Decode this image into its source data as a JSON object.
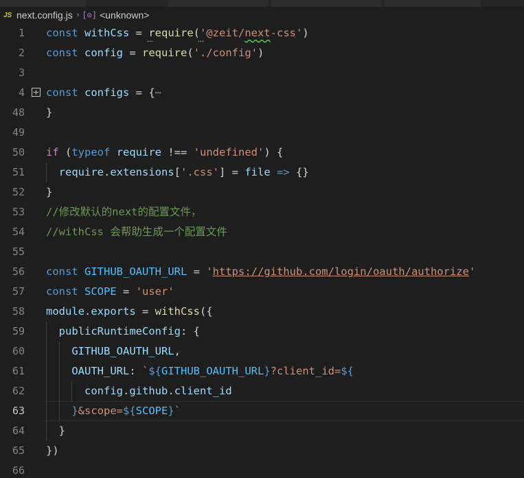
{
  "breadcrumb": {
    "file_badge": "JS",
    "file_name": "next.config.js",
    "separator": "›",
    "symbol_badge": "[⊙]",
    "symbol_name": "<unknown>"
  },
  "active_line": "63",
  "lines": [
    {
      "n": "1",
      "tokens": [
        [
          "kw",
          "const"
        ],
        [
          "pun",
          " "
        ],
        [
          "var",
          "withCss"
        ],
        [
          "pun",
          " = "
        ],
        [
          "fn",
          "require"
        ],
        [
          "pun",
          "("
        ],
        [
          "str",
          "'@zeit/next-css'"
        ],
        [
          "pun",
          ")"
        ]
      ]
    },
    {
      "n": "2",
      "tokens": [
        [
          "kw",
          "const"
        ],
        [
          "pun",
          " "
        ],
        [
          "var",
          "config"
        ],
        [
          "pun",
          " = "
        ],
        [
          "fn",
          "require"
        ],
        [
          "pun",
          "("
        ],
        [
          "str",
          "'./config'"
        ],
        [
          "pun",
          ")"
        ]
      ]
    },
    {
      "n": "3",
      "tokens": []
    },
    {
      "n": "4",
      "tokens": [
        [
          "kw",
          "const"
        ],
        [
          "pun",
          " "
        ],
        [
          "var",
          "configs"
        ],
        [
          "pun",
          " = {"
        ],
        [
          "fold-ell",
          "⋯"
        ]
      ]
    },
    {
      "n": "48",
      "tokens": [
        [
          "pun",
          "}"
        ]
      ]
    },
    {
      "n": "49",
      "tokens": []
    },
    {
      "n": "50",
      "tokens": [
        [
          "ctl",
          "if"
        ],
        [
          "pun",
          " ("
        ],
        [
          "kw",
          "typeof"
        ],
        [
          "pun",
          " "
        ],
        [
          "var",
          "require"
        ],
        [
          "pun",
          " !== "
        ],
        [
          "str",
          "'undefined'"
        ],
        [
          "pun",
          ") {"
        ]
      ]
    },
    {
      "n": "51",
      "tokens": [
        [
          "pun",
          "  "
        ],
        [
          "var",
          "require"
        ],
        [
          "pun",
          "."
        ],
        [
          "var",
          "extensions"
        ],
        [
          "pun",
          "["
        ],
        [
          "str",
          "'.css'"
        ],
        [
          "pun",
          "] = "
        ],
        [
          "var",
          "file"
        ],
        [
          "pun",
          " "
        ],
        [
          "kw",
          "=>"
        ],
        [
          "pun",
          " {}"
        ]
      ]
    },
    {
      "n": "52",
      "tokens": [
        [
          "pun",
          "}"
        ]
      ]
    },
    {
      "n": "53",
      "tokens": [
        [
          "cm",
          "//修改默认的next的配置文件，"
        ]
      ]
    },
    {
      "n": "54",
      "tokens": [
        [
          "cm",
          "//withCss 会帮助生成一个配置文件"
        ]
      ]
    },
    {
      "n": "55",
      "tokens": []
    },
    {
      "n": "56",
      "tokens": [
        [
          "kw",
          "const"
        ],
        [
          "pun",
          " "
        ],
        [
          "const",
          "GITHUB_OAUTH_URL"
        ],
        [
          "pun",
          " = "
        ],
        [
          "str",
          "'"
        ],
        [
          "str link",
          "https://github.com/login/oauth/authorize"
        ],
        [
          "str",
          "'"
        ]
      ]
    },
    {
      "n": "57",
      "tokens": [
        [
          "kw",
          "const"
        ],
        [
          "pun",
          " "
        ],
        [
          "const",
          "SCOPE"
        ],
        [
          "pun",
          " = "
        ],
        [
          "str",
          "'user'"
        ]
      ]
    },
    {
      "n": "58",
      "tokens": [
        [
          "var",
          "module"
        ],
        [
          "pun",
          "."
        ],
        [
          "var",
          "exports"
        ],
        [
          "pun",
          " = "
        ],
        [
          "fn",
          "withCss"
        ],
        [
          "pun",
          "({"
        ]
      ]
    },
    {
      "n": "59",
      "tokens": [
        [
          "pun",
          "  "
        ],
        [
          "var",
          "publicRuntimeConfig"
        ],
        [
          "pun",
          ": {"
        ]
      ]
    },
    {
      "n": "60",
      "tokens": [
        [
          "pun",
          "    "
        ],
        [
          "var",
          "GITHUB_OAUTH_URL"
        ],
        [
          "pun",
          ","
        ]
      ]
    },
    {
      "n": "61",
      "tokens": [
        [
          "pun",
          "    "
        ],
        [
          "var",
          "OAUTH_URL"
        ],
        [
          "pun",
          ": "
        ],
        [
          "str",
          "`"
        ],
        [
          "tpl",
          "${"
        ],
        [
          "const",
          "GITHUB_OAUTH_URL"
        ],
        [
          "tpl",
          "}"
        ],
        [
          "str",
          "?client_id="
        ],
        [
          "tpl",
          "${"
        ]
      ]
    },
    {
      "n": "62",
      "tokens": [
        [
          "pun",
          "      "
        ],
        [
          "var",
          "config"
        ],
        [
          "pun",
          "."
        ],
        [
          "var",
          "github"
        ],
        [
          "pun",
          "."
        ],
        [
          "var",
          "client_id"
        ]
      ]
    },
    {
      "n": "63",
      "tokens": [
        [
          "pun",
          "    "
        ],
        [
          "tpl",
          "}"
        ],
        [
          "str",
          "&scope="
        ],
        [
          "tpl",
          "${"
        ],
        [
          "const",
          "SCOPE"
        ],
        [
          "tpl",
          "}"
        ],
        [
          "str",
          "`"
        ]
      ]
    },
    {
      "n": "64",
      "tokens": [
        [
          "pun",
          "  }"
        ]
      ]
    },
    {
      "n": "65",
      "tokens": [
        [
          "pun",
          "})"
        ]
      ]
    },
    {
      "n": "66",
      "tokens": []
    }
  ]
}
